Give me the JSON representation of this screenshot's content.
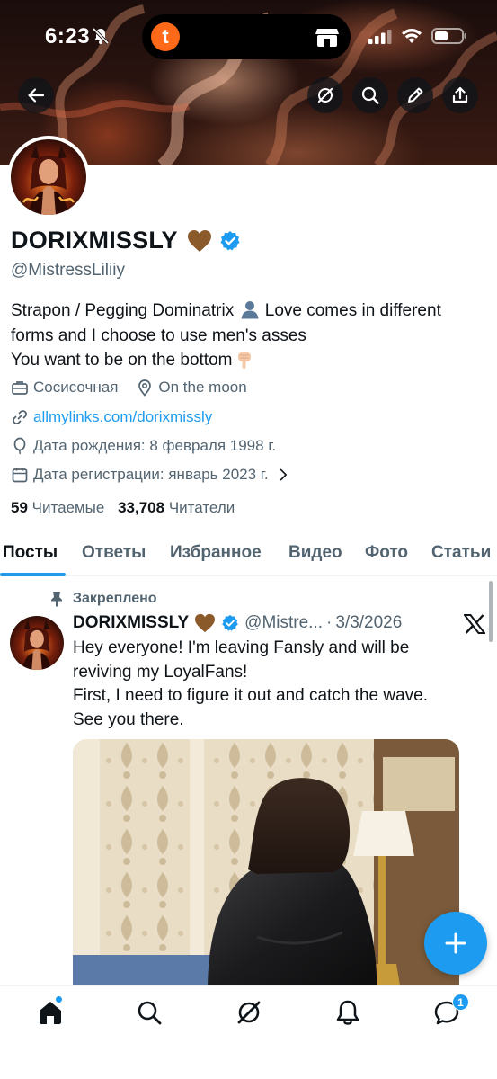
{
  "status_bar": {
    "time": "6:23",
    "island_app_letter": "t"
  },
  "profile": {
    "display_name": "DORIXMISSLY",
    "handle": "@MistressLiliiy",
    "bio_lines": [
      "Strapon / Pegging Dominatrix",
      "Love comes in different",
      "forms and I choose to use men's asses",
      "You want to be on the bottom"
    ],
    "professional_category": "Сосисочная",
    "location": "On the moon",
    "website": "allmylinks.com/dorixmissly",
    "birth_date": "Дата рождения: 8 февраля 1998 г.",
    "join_date": "Дата регистрации: январь 2023 г.",
    "following_count": "59",
    "following_label": "Читаемые",
    "followers_count": "33,708",
    "followers_label": "Читатели"
  },
  "tabs": [
    {
      "label": "Посты",
      "active": true
    },
    {
      "label": "Ответы",
      "active": false
    },
    {
      "label": "Избранное",
      "active": false
    },
    {
      "label": "Видео",
      "active": false
    },
    {
      "label": "Фото",
      "active": false
    },
    {
      "label": "Статьи",
      "active": false
    }
  ],
  "post": {
    "pinned_label": "Закреплено",
    "author_name": "DORIXMISSLY",
    "author_handle": "@Mistre...",
    "separator": "·",
    "date": "3/3/2026",
    "text_lines": [
      "Hey everyone! I'm leaving Fansly and will be",
      "reviving my LoyalFans!",
      "First, I need to figure it out and catch the wave.",
      "See you there."
    ]
  },
  "bottom_nav": {
    "items": [
      "home-icon",
      "search-icon",
      "grok-icon",
      "notifications-icon",
      "messages-icon"
    ],
    "messages_badge": "1"
  },
  "colors": {
    "accent": "#1d9bf0",
    "text_primary": "#0f1419",
    "text_secondary": "#536471",
    "heart_brown": "#8b5a2b"
  }
}
